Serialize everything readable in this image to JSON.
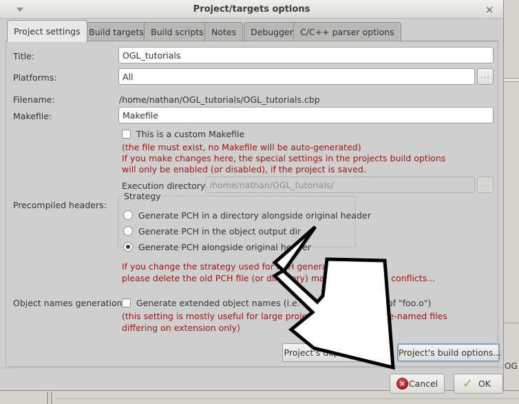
{
  "window": {
    "title": "Project/targets options",
    "menu_caret_icon": "caret-down-icon",
    "close_icon": "×"
  },
  "tabs": [
    {
      "label": "Project settings",
      "active": true
    },
    {
      "label": "Build targets",
      "active": false
    },
    {
      "label": "Build scripts",
      "active": false
    },
    {
      "label": "Notes",
      "active": false
    },
    {
      "label": "Debugger",
      "active": false
    },
    {
      "label": "C/C++ parser options",
      "active": false
    }
  ],
  "form": {
    "title_label": "Title:",
    "title_value": "OGL_tutorials",
    "platforms_label": "Platforms:",
    "platforms_value": "All",
    "platforms_browse": "...",
    "filename_label": "Filename:",
    "filename_value": "/home/nathan/OGL_tutorials/OGL_tutorials.cbp",
    "makefile_label": "Makefile:",
    "makefile_value": "Makefile",
    "custom_makefile_label": "This is a custom Makefile",
    "custom_makefile_checked": false,
    "warn_line1": "(the file must exist, no Makefile will be auto-generated)",
    "warn_line2": "If you make changes here, the special settings in the projects build options",
    "warn_line3": "will only be enabled (or disabled), if the project is saved.",
    "exec_dir_label": "Execution directory:",
    "exec_dir_value": "/home/nathan/OGL_tutorials/",
    "exec_dir_browse": "..."
  },
  "pch": {
    "label": "Precompiled headers:",
    "group_legend": "Strategy",
    "options": [
      {
        "label": "Generate PCH in a directory alongside original header",
        "selected": false
      },
      {
        "label": "Generate PCH in the object output dir",
        "selected": false
      },
      {
        "label": "Generate PCH alongside original header",
        "selected": true
      }
    ],
    "warn_line1": "If you change the strategy used for PCH generation,",
    "warn_line2": "please delete the old PCH file (or directory) manually to avoid conflicts..."
  },
  "object_names": {
    "label": "Object names generation:",
    "checkbox_label": "Generate extended object names (i.e. \"foo.cpp.o\" instead of \"foo.o\")",
    "checked": false,
    "warn_line1": "(this setting is mostly useful for large projects containing same-named files",
    "warn_line2": "differing on extension only)"
  },
  "buttons": {
    "dependencies": "Project's dependencies...",
    "build_options": "Project's build options...",
    "cancel": "Cancel",
    "ok": "OK",
    "cancel_icon": "×",
    "ok_icon": "✓"
  },
  "background": {
    "right_text": "OG"
  },
  "colors": {
    "dialog_bg": "#cfcfcd",
    "warning_red": "#9c1414",
    "focus_blue": "#7e9cc1",
    "tab_active": "#e9e9e7",
    "tab_inactive": "#b9b9b6"
  }
}
